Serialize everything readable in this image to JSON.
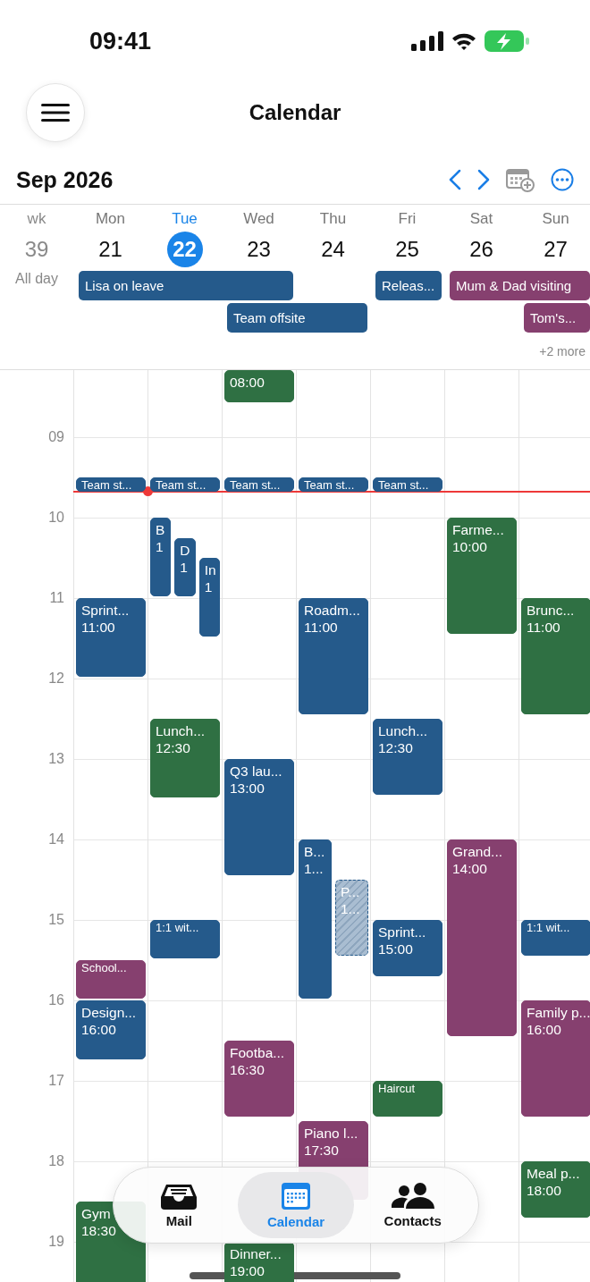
{
  "status_bar": {
    "time": "09:41"
  },
  "nav": {
    "title": "Calendar"
  },
  "month": {
    "label": "Sep 2026"
  },
  "week": {
    "label": "wk",
    "number": "39"
  },
  "days": [
    {
      "name": "Mon",
      "date": "21",
      "selected": false
    },
    {
      "name": "Tue",
      "date": "22",
      "selected": true
    },
    {
      "name": "Wed",
      "date": "23",
      "selected": false
    },
    {
      "name": "Thu",
      "date": "24",
      "selected": false
    },
    {
      "name": "Fri",
      "date": "25",
      "selected": false
    },
    {
      "name": "Sat",
      "date": "26",
      "selected": false
    },
    {
      "name": "Sun",
      "date": "27",
      "selected": false
    }
  ],
  "all_day": {
    "label": "All day",
    "more": "+2 more",
    "events": [
      {
        "title": "Lisa on leave",
        "color": "#255a8b"
      },
      {
        "title": "Team offsite",
        "color": "#255a8b"
      },
      {
        "title": "Releas...",
        "color": "#255a8b"
      },
      {
        "title": "Mum & Dad visiting",
        "color": "#86406f"
      },
      {
        "title": "Tom's...",
        "color": "#86406f"
      }
    ]
  },
  "grid": {
    "hours": [
      "09",
      "10",
      "11",
      "12",
      "13",
      "14",
      "15",
      "16",
      "17",
      "18",
      "19"
    ],
    "columns": [
      {
        "events": [
          {
            "kind": "event",
            "title": "Team st...",
            "color": "#255a8b"
          },
          {
            "kind": "event",
            "title": "Sprint...",
            "time": "11:00",
            "color": "#255a8b"
          },
          {
            "kind": "event",
            "title": "School...",
            "color": "#86406f"
          },
          {
            "kind": "event",
            "title": "Design...",
            "time": "16:00",
            "color": "#255a8b"
          },
          {
            "kind": "event",
            "title": "Gym",
            "time": "18:30",
            "color": "#2f7043"
          }
        ]
      },
      {
        "events": [
          {
            "kind": "event",
            "title": "Team st...",
            "color": "#255a8b"
          },
          {
            "kind": "event",
            "title": "B",
            "time": "1",
            "color": "#255a8b"
          },
          {
            "kind": "event",
            "title": "D",
            "time": "1",
            "color": "#255a8b"
          },
          {
            "kind": "event",
            "title": "In",
            "time": "1",
            "color": "#255a8b"
          },
          {
            "kind": "event",
            "title": "Lunch...",
            "time": "12:30",
            "color": "#2f7043"
          },
          {
            "kind": "event",
            "title": "1:1 wit...",
            "color": "#255a8b"
          }
        ]
      },
      {
        "events": [
          {
            "kind": "event",
            "time": "08:00",
            "color": "#2f7043"
          },
          {
            "kind": "event",
            "title": "Team st...",
            "color": "#255a8b"
          },
          {
            "kind": "event",
            "title": "Q3 lau...",
            "time": "13:00",
            "color": "#255a8b"
          },
          {
            "kind": "event",
            "title": "Footba...",
            "time": "16:30",
            "color": "#86406f"
          },
          {
            "kind": "event",
            "title": "Dinner...",
            "time": "19:00",
            "color": "#2f7043"
          }
        ]
      },
      {
        "events": [
          {
            "kind": "event",
            "title": "Team st...",
            "color": "#255a8b"
          },
          {
            "kind": "event",
            "title": "Roadm...",
            "time": "11:00",
            "color": "#255a8b"
          },
          {
            "kind": "event",
            "title": "B...",
            "time": "1...",
            "color": "#255a8b"
          },
          {
            "kind": "tentative",
            "title": "P...",
            "time": "1...",
            "color": "#255a8b"
          },
          {
            "kind": "event",
            "title": "Piano l...",
            "time": "17:30",
            "color": "#86406f"
          }
        ]
      },
      {
        "events": [
          {
            "kind": "event",
            "title": "Team st...",
            "color": "#255a8b"
          },
          {
            "kind": "event",
            "title": "Lunch...",
            "time": "12:30",
            "color": "#255a8b"
          },
          {
            "kind": "event",
            "title": "Sprint...",
            "time": "15:00",
            "color": "#255a8b"
          },
          {
            "kind": "event",
            "title": "Haircut",
            "color": "#2f7043"
          }
        ]
      },
      {
        "events": [
          {
            "kind": "event",
            "title": "Farme...",
            "time": "10:00",
            "color": "#2f7043"
          },
          {
            "kind": "event",
            "title": "Grand...",
            "time": "14:00",
            "color": "#86406f"
          }
        ]
      },
      {
        "events": [
          {
            "kind": "event",
            "title": "Brunc...",
            "time": "11:00",
            "color": "#2f7043"
          },
          {
            "kind": "event",
            "title": "1:1 wit...",
            "color": "#255a8b"
          },
          {
            "kind": "event",
            "title": "Family p...",
            "time": "16:00",
            "color": "#86406f"
          },
          {
            "kind": "event",
            "title": "Meal p...",
            "time": "18:00",
            "color": "#2f7043"
          }
        ]
      }
    ]
  },
  "tab_bar": [
    {
      "label": "Mail",
      "selected": false
    },
    {
      "label": "Calendar",
      "selected": true
    },
    {
      "label": "Contacts",
      "selected": false
    }
  ]
}
